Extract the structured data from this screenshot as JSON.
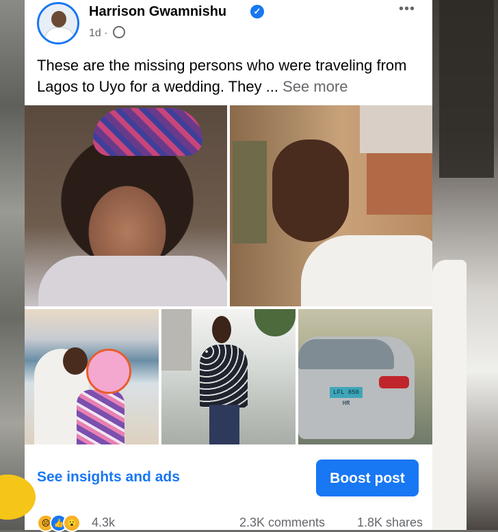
{
  "post": {
    "author": "Harrison Gwamnishu",
    "verified_icon": "verified-badge-icon",
    "time": "1d",
    "separator": "·",
    "audience_icon": "globe-icon",
    "more_menu": "•••",
    "caption_text": "These are the missing persons who were traveling from Lagos to Uyo for a wedding. They ... ",
    "see_more": "See more",
    "plate_text": "LFL 850 HR"
  },
  "actions": {
    "insights_label": "See insights and ads",
    "boost_label": "Boost post"
  },
  "stats": {
    "reaction_icons": [
      "sad-reaction-icon",
      "like-reaction-icon",
      "wow-reaction-icon"
    ],
    "reaction_count": "4.3k",
    "comments": "2.3K comments",
    "shares": "1.8K shares"
  },
  "colors": {
    "accent": "#1877f2",
    "secondary_text": "#65676b"
  }
}
